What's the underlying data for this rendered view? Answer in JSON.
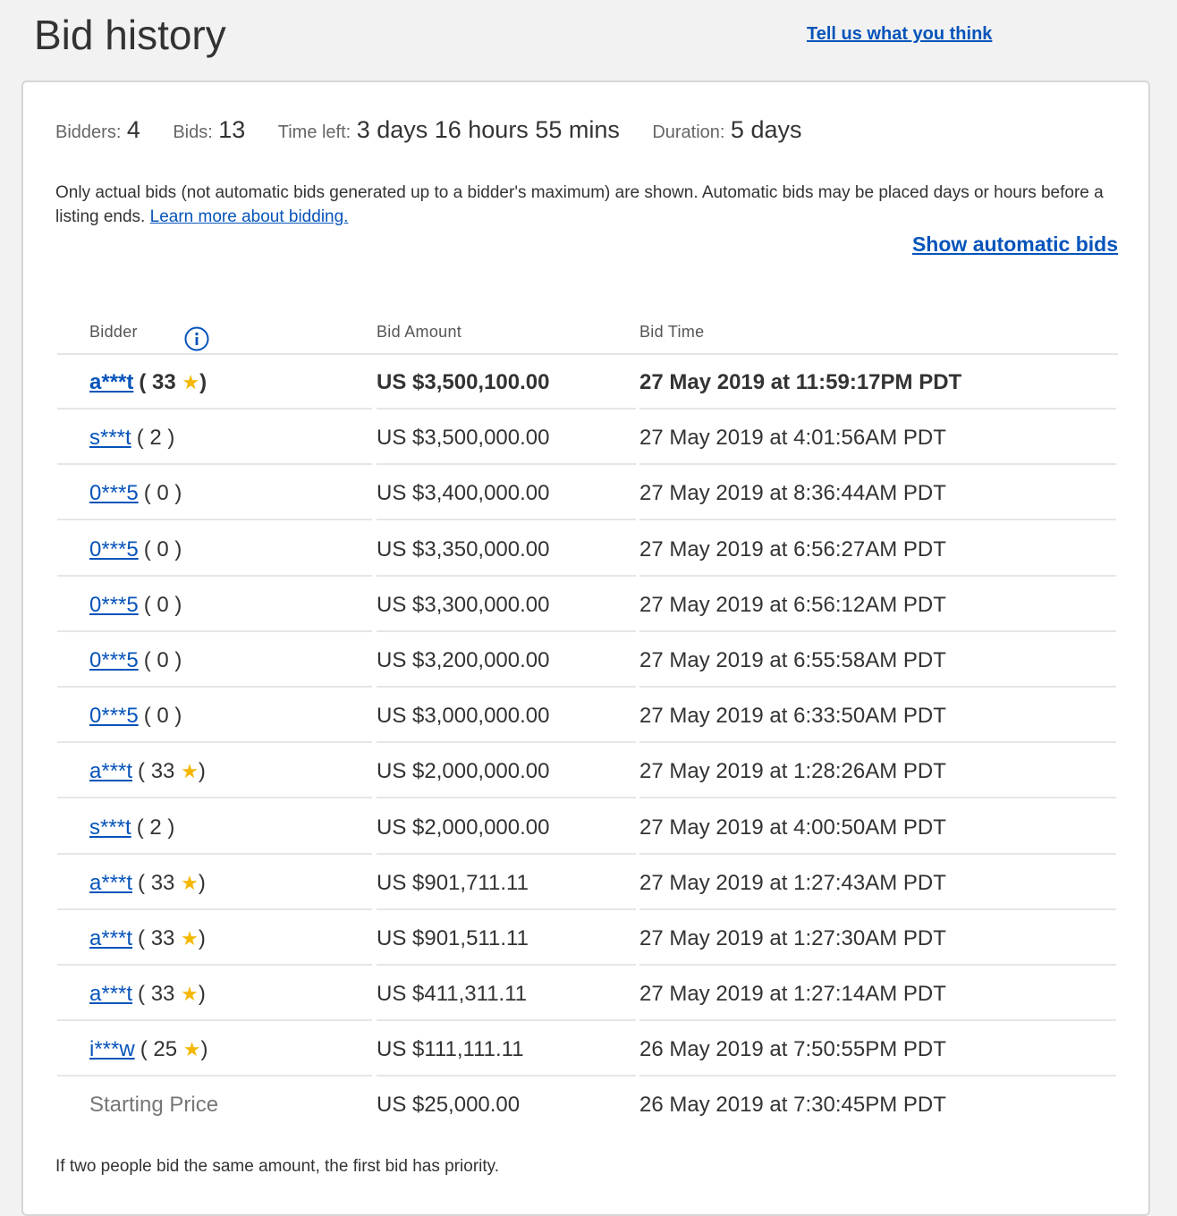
{
  "header": {
    "title": "Bid history",
    "feedback_link": "Tell us what you think"
  },
  "summary": {
    "bidders_label": "Bidders:",
    "bidders_value": "4",
    "bids_label": "Bids:",
    "bids_value": "13",
    "time_left_label": "Time left:",
    "time_left_value": "3 days 16 hours 55 mins",
    "duration_label": "Duration:",
    "duration_value": "5 days"
  },
  "note": {
    "text": "Only actual bids (not automatic bids generated up to a bidder's maximum) are shown. Automatic bids may be placed days or hours before a listing ends. ",
    "learn_more": "Learn more about bidding."
  },
  "show_auto_bids": "Show automatic bids",
  "table": {
    "columns": [
      "Bidder",
      "Bid Amount",
      "Bid Time"
    ],
    "rows": [
      {
        "bidder": "a***t",
        "feedback_open": "( 33",
        "star": "★",
        "feedback_close": ")",
        "amount": "US $3,500,100.00",
        "time": "27 May 2019 at 11:59:17PM PDT"
      },
      {
        "bidder": "s***t",
        "feedback_open": "( 2 )",
        "star": "",
        "feedback_close": "",
        "amount": "US $3,500,000.00",
        "time": "27 May 2019 at 4:01:56AM PDT"
      },
      {
        "bidder": "0***5",
        "feedback_open": "( 0 )",
        "star": "",
        "feedback_close": "",
        "amount": "US $3,400,000.00",
        "time": "27 May 2019 at 8:36:44AM PDT"
      },
      {
        "bidder": "0***5",
        "feedback_open": "( 0 )",
        "star": "",
        "feedback_close": "",
        "amount": "US $3,350,000.00",
        "time": "27 May 2019 at 6:56:27AM PDT"
      },
      {
        "bidder": "0***5",
        "feedback_open": "( 0 )",
        "star": "",
        "feedback_close": "",
        "amount": "US $3,300,000.00",
        "time": "27 May 2019 at 6:56:12AM PDT"
      },
      {
        "bidder": "0***5",
        "feedback_open": "( 0 )",
        "star": "",
        "feedback_close": "",
        "amount": "US $3,200,000.00",
        "time": "27 May 2019 at 6:55:58AM PDT"
      },
      {
        "bidder": "0***5",
        "feedback_open": "( 0 )",
        "star": "",
        "feedback_close": "",
        "amount": "US $3,000,000.00",
        "time": "27 May 2019 at 6:33:50AM PDT"
      },
      {
        "bidder": "a***t",
        "feedback_open": "( 33",
        "star": "★",
        "feedback_close": ")",
        "amount": "US $2,000,000.00",
        "time": "27 May 2019 at 1:28:26AM PDT"
      },
      {
        "bidder": "s***t",
        "feedback_open": "( 2 )",
        "star": "",
        "feedback_close": "",
        "amount": "US $2,000,000.00",
        "time": "27 May 2019 at 4:00:50AM PDT"
      },
      {
        "bidder": "a***t",
        "feedback_open": "( 33",
        "star": "★",
        "feedback_close": ")",
        "amount": "US $901,711.11",
        "time": "27 May 2019 at 1:27:43AM PDT"
      },
      {
        "bidder": "a***t",
        "feedback_open": "( 33",
        "star": "★",
        "feedback_close": ")",
        "amount": "US $901,511.11",
        "time": "27 May 2019 at 1:27:30AM PDT"
      },
      {
        "bidder": "a***t",
        "feedback_open": "( 33",
        "star": "★",
        "feedback_close": ")",
        "amount": "US $411,311.11",
        "time": "27 May 2019 at 1:27:14AM PDT"
      },
      {
        "bidder": "i***w",
        "feedback_open": "( 25",
        "star": "★",
        "feedback_close": ")",
        "amount": "US $111,111.11",
        "time": "26 May 2019 at 7:50:55PM PDT"
      }
    ],
    "starting": {
      "label": "Starting Price",
      "amount": "US $25,000.00",
      "time": "26 May 2019 at 7:30:45PM PDT"
    }
  },
  "footnote": "If two people bid the same amount, the first bid has priority.",
  "colors": {
    "link": "#0654ba",
    "star": "#f5b800"
  }
}
